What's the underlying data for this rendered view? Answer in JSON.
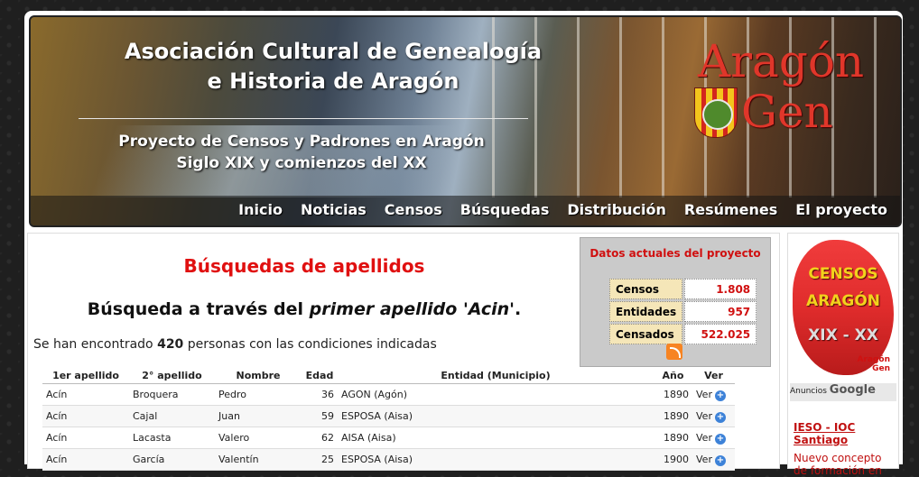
{
  "header": {
    "title_line1": "Asociación Cultural de Genealogía",
    "title_line2": "e Historia de Aragón",
    "subtitle_line1": "Proyecto de Censos y Padrones en Aragón",
    "subtitle_line2": "Siglo XIX y comienzos del XX",
    "logo_word1": "Aragón",
    "logo_word2": "Gen"
  },
  "nav": [
    "Inicio",
    "Noticias",
    "Censos",
    "Búsquedas",
    "Distribución",
    "Resúmenes",
    "El proyecto"
  ],
  "main": {
    "heading": "Búsquedas de apellidos",
    "search_prefix": "Búsqueda a través del ",
    "search_em": "primer apellido 'Acin'",
    "search_suffix": ".",
    "found_prefix": "Se han encontrado ",
    "found_count": "420",
    "found_suffix": " personas con las condiciones indicadas"
  },
  "stats": {
    "title": "Datos actuales del proyecto",
    "rows": [
      {
        "label": "Censos",
        "value": "1.808"
      },
      {
        "label": "Entidades",
        "value": "957"
      },
      {
        "label": "Censados",
        "value": "522.025"
      }
    ]
  },
  "table": {
    "headers": [
      "1er apellido",
      "2° apellido",
      "Nombre",
      "Edad",
      "Entidad (Municipio)",
      "Año",
      "Ver"
    ],
    "rows": [
      [
        "Acín",
        "Broquera",
        "Pedro",
        "36",
        "AGON (Agón)",
        "1890",
        "Ver"
      ],
      [
        "Acín",
        "Cajal",
        "Juan",
        "59",
        "ESPOSA (Aisa)",
        "1890",
        "Ver"
      ],
      [
        "Acín",
        "Lacasta",
        "Valero",
        "62",
        "AISA (Aisa)",
        "1890",
        "Ver"
      ],
      [
        "Acín",
        "García",
        "Valentín",
        "25",
        "ESPOSA (Aisa)",
        "1900",
        "Ver"
      ]
    ]
  },
  "sidebar": {
    "map_line1": "CENSOS",
    "map_line2": "ARAGÓN",
    "map_line3": "XIX - XX",
    "map_logo1": "Aragón",
    "map_logo2": "Gen",
    "ads_label": "Anuncios",
    "ads_brand": "Google",
    "ad_link": "IESO - IOC Santiago",
    "ad_text": "Nuevo concepto de formación en"
  }
}
